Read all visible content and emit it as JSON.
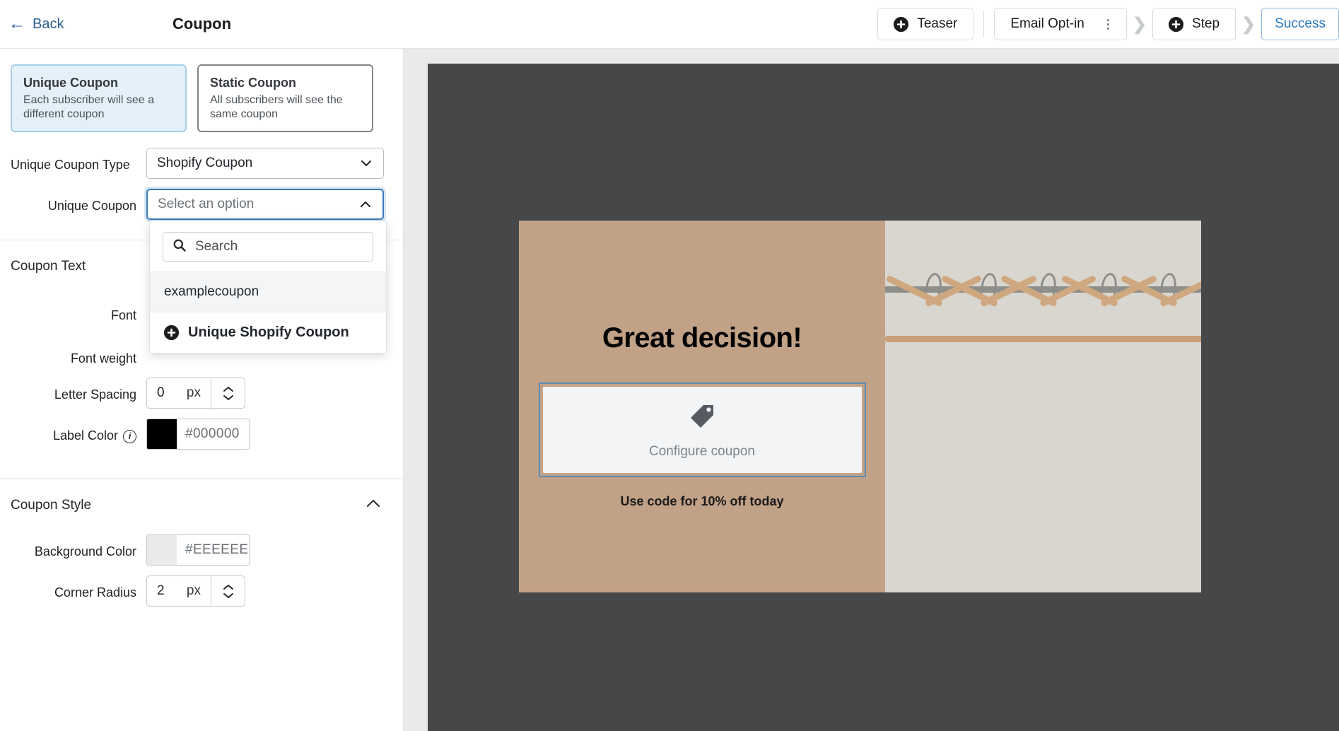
{
  "topbar": {
    "back_label": "Back",
    "panel_title": "Coupon",
    "teaser_label": "Teaser",
    "step_chip_label": "Email Opt-in",
    "step_label": "Step",
    "success_label": "Success",
    "chevron": "❯",
    "accent_blue": "#2878bd"
  },
  "coupon_types": [
    {
      "title": "Unique Coupon",
      "desc": "Each subscriber will see a different coupon",
      "selected": true
    },
    {
      "title": "Static Coupon",
      "desc": "All subscribers will see the same coupon",
      "selected": false
    }
  ],
  "fields": {
    "unique_coupon_type": {
      "label": "Unique Coupon Type",
      "value": "Shopify Coupon"
    },
    "unique_coupon": {
      "label": "Unique Coupon",
      "placeholder": "Select an option"
    }
  },
  "dropdown": {
    "search_placeholder": "Search",
    "search_value": "",
    "options": [
      "examplecoupon"
    ],
    "action_label": "Unique Shopify Coupon"
  },
  "coupon_text": {
    "section_title": "Coupon Text",
    "rows": {
      "font_label": "Font",
      "font_weight_label": "Font weight",
      "letter_spacing_label": "Letter Spacing",
      "letter_spacing_value": "0",
      "letter_spacing_unit": "px",
      "label_color_label": "Label Color",
      "label_color_hex": "#000000",
      "label_color_swatch": "#000000"
    }
  },
  "coupon_style": {
    "section_title": "Coupon Style",
    "background_color_label": "Background Color",
    "background_color_hex": "#EEEEEE",
    "background_color_swatch": "#EAEAEA",
    "corner_radius_label": "Corner Radius",
    "corner_radius_value": "2",
    "corner_radius_unit": "px"
  },
  "preview": {
    "heading": "Great decision!",
    "configure_label": "Configure coupon",
    "subtext": "Use code for 10% off today",
    "popup_bg": "#c2a287",
    "canvas_bg": "#464749"
  }
}
